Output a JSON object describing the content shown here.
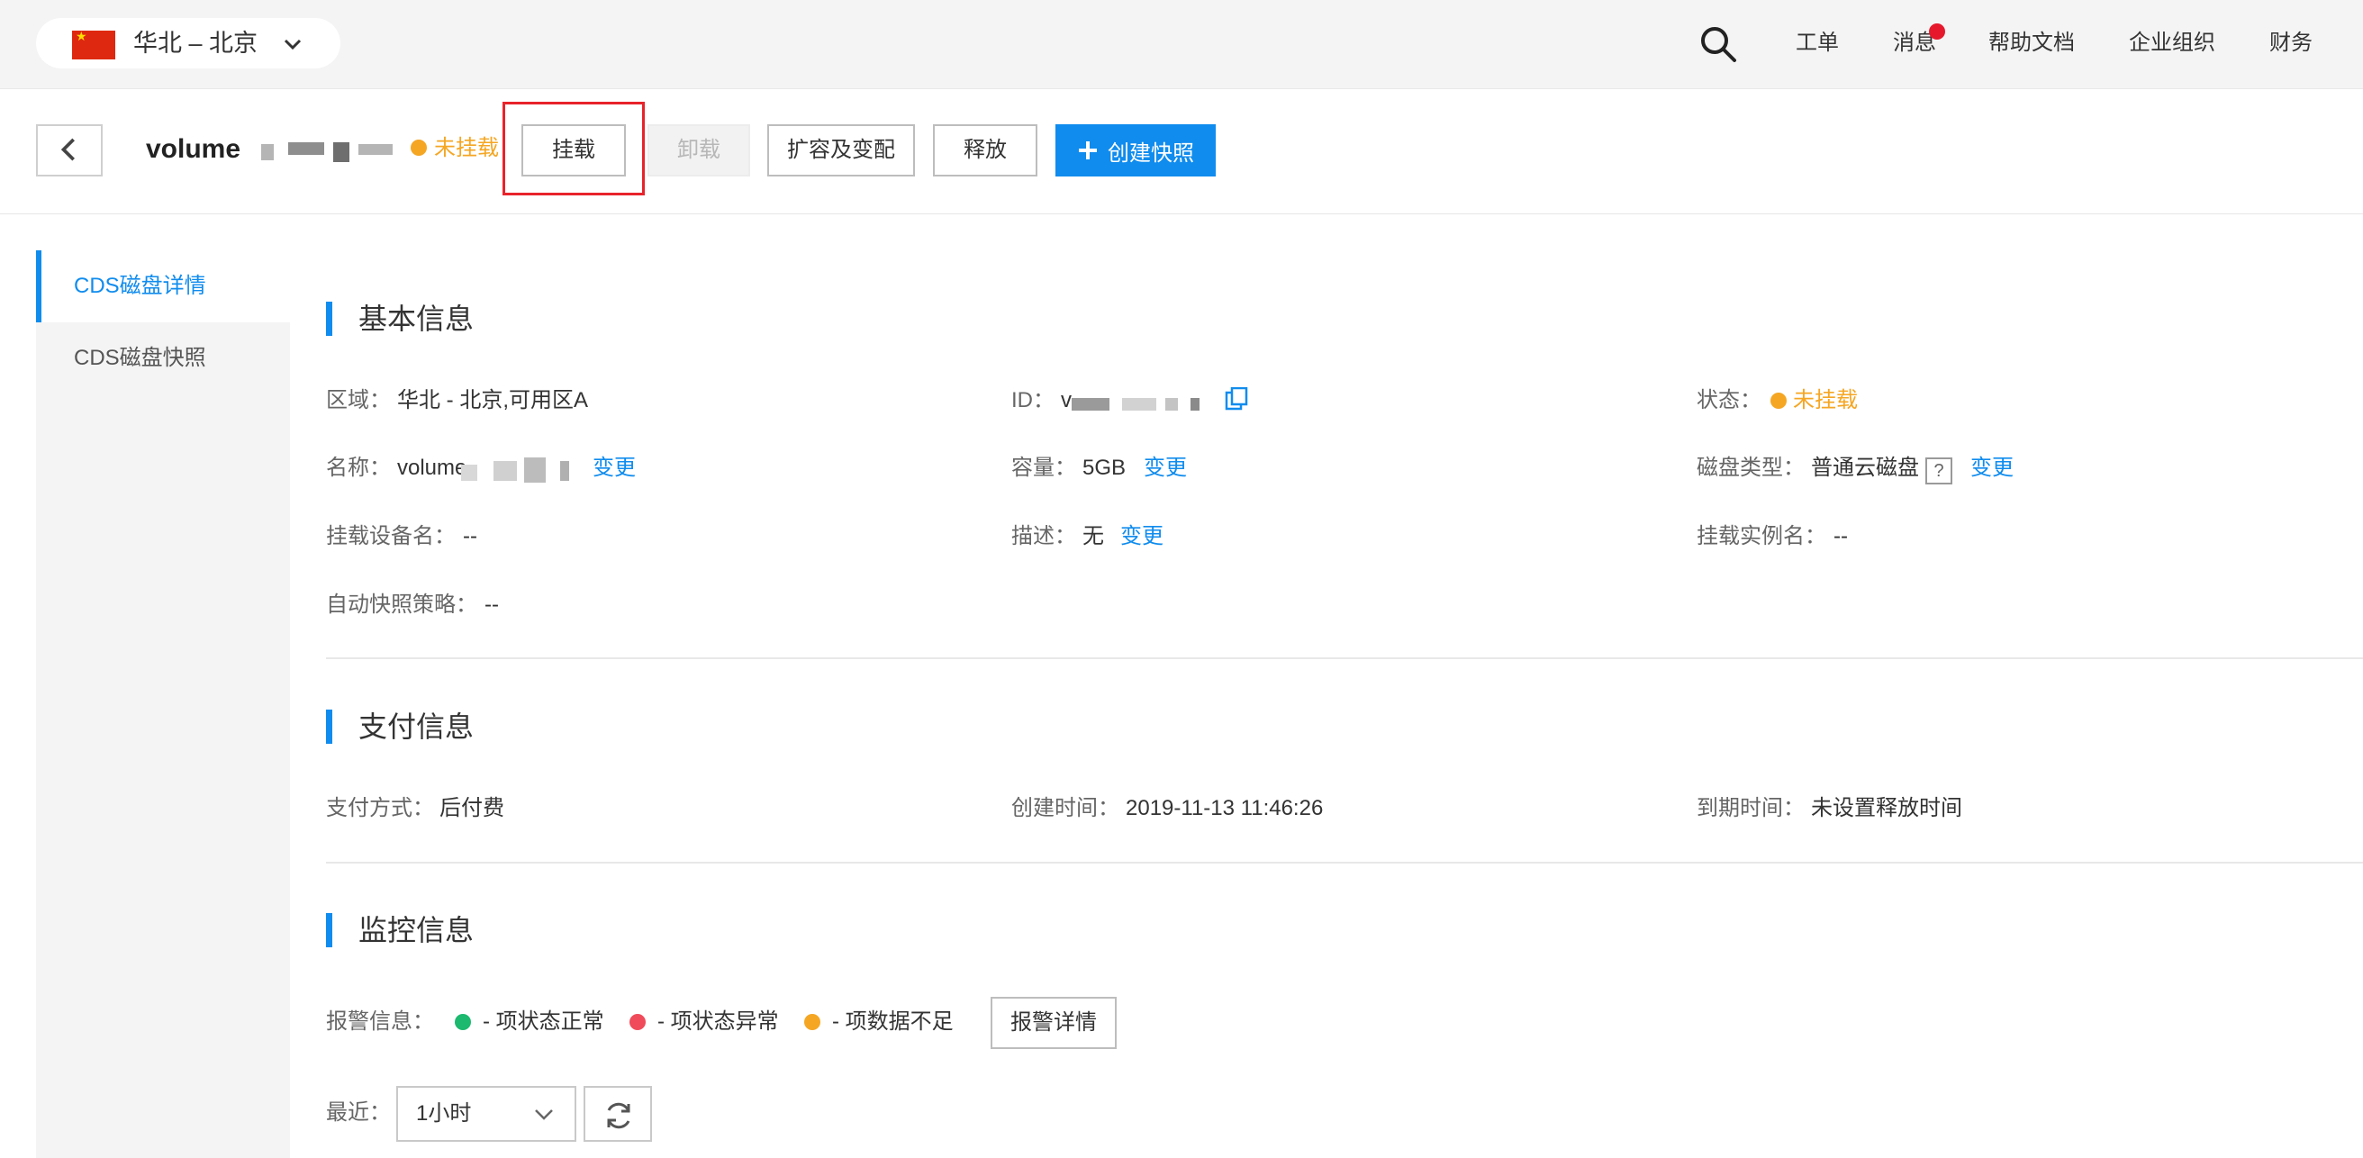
{
  "topnav": {
    "region": "华北 – 北京",
    "links": [
      "工单",
      "消息",
      "帮助文档",
      "企业组织",
      "财务"
    ]
  },
  "header": {
    "title": "volume",
    "status": "未挂载",
    "buttons": {
      "attach": "挂载",
      "detach": "卸载",
      "resize": "扩容及变配",
      "release": "释放",
      "snapshot": "创建快照"
    }
  },
  "sidebar": {
    "items": [
      "CDS磁盘详情",
      "CDS磁盘快照"
    ]
  },
  "basic": {
    "title": "基本信息",
    "region_label": "区域：",
    "region_value": "华北 - 北京,可用区A",
    "id_label": "ID：",
    "id_value": "v",
    "status_label": "状态：",
    "status_value": "未挂载",
    "name_label": "名称：",
    "name_value": "volume",
    "name_change": "变更",
    "capacity_label": "容量：",
    "capacity_value": "5GB",
    "capacity_change": "变更",
    "disktype_label": "磁盘类型：",
    "disktype_value": "普通云磁盘",
    "disktype_help": "?",
    "disktype_change": "变更",
    "device_label": "挂载设备名：",
    "device_value": "--",
    "desc_label": "描述：",
    "desc_value": "无",
    "desc_change": "变更",
    "instance_label": "挂载实例名：",
    "instance_value": "--",
    "autosnap_label": "自动快照策略：",
    "autosnap_value": "--"
  },
  "payment": {
    "title": "支付信息",
    "method_label": "支付方式：",
    "method_value": "后付费",
    "created_label": "创建时间：",
    "created_value": "2019-11-13 11:46:26",
    "expire_label": "到期时间：",
    "expire_value": "未设置释放时间"
  },
  "monitor": {
    "title": "监控信息",
    "alarm_label": "报警信息：",
    "legend": [
      {
        "text": "- 项状态正常",
        "color": "#1cb96e"
      },
      {
        "text": "- 项状态异常",
        "color": "#f04b5a"
      },
      {
        "text": "- 项数据不足",
        "color": "#f5a623"
      }
    ],
    "alarm_detail_button": "报警详情",
    "recent_label": "最近：",
    "recent_value": "1小时"
  },
  "colors": {
    "accent": "#108cee",
    "warning": "#f5a623",
    "highlight": "#e8232b"
  }
}
